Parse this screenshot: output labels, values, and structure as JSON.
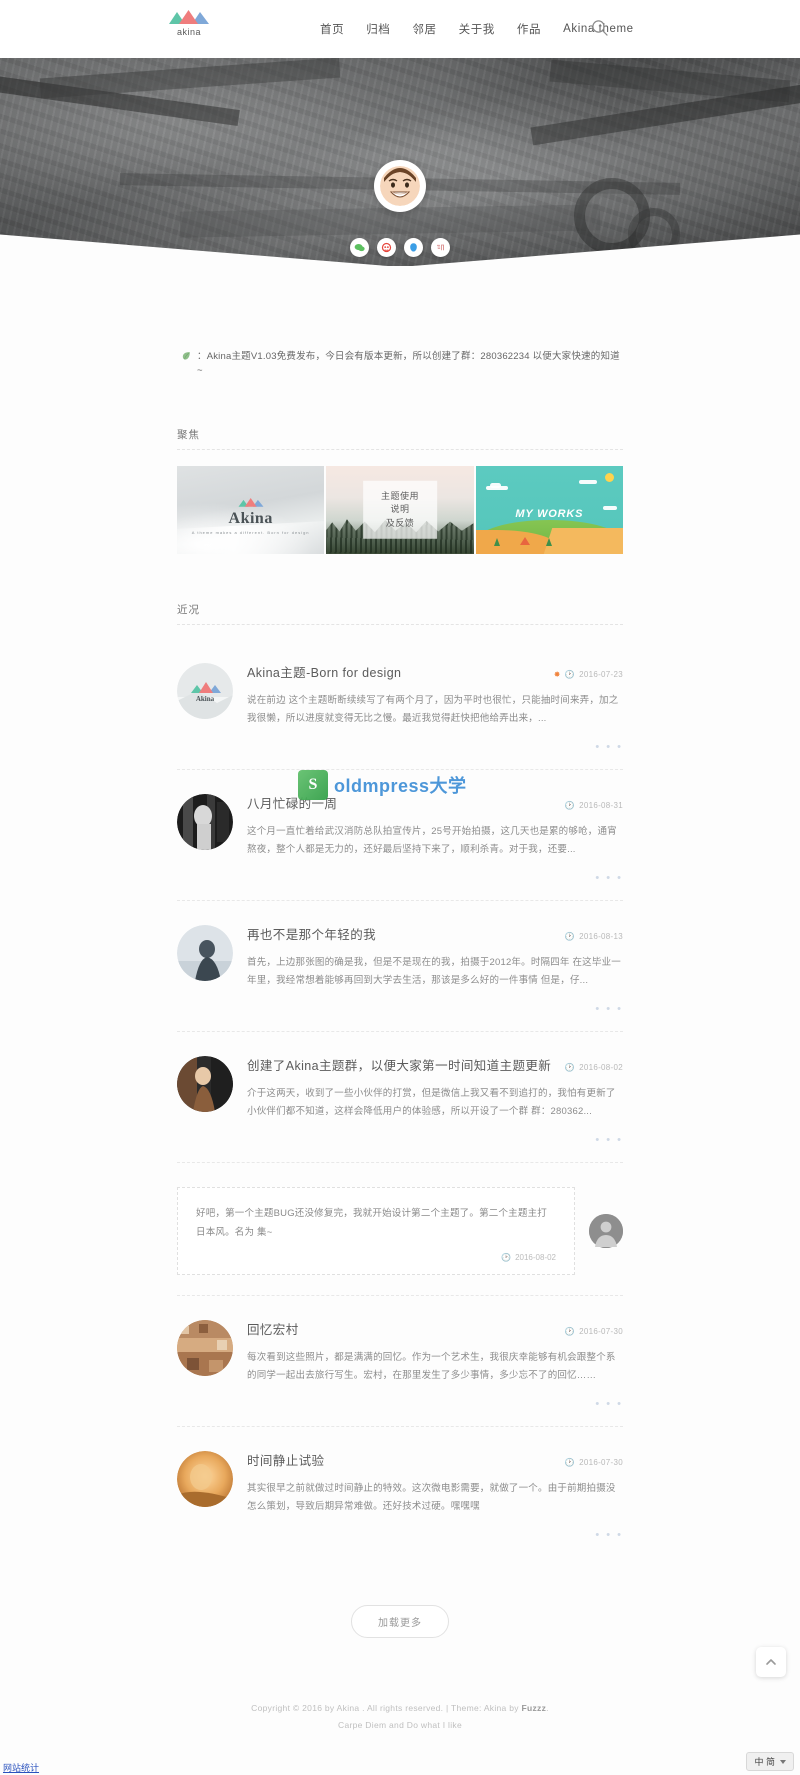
{
  "site": {
    "logo_word": "akina",
    "nav": [
      {
        "label": "首页"
      },
      {
        "label": "归档"
      },
      {
        "label": "邻居"
      },
      {
        "label": "关于我"
      },
      {
        "label": "作品"
      },
      {
        "label": "Akina theme"
      }
    ],
    "search_icon": "search-icon"
  },
  "hero": {
    "avatar_alt": "avatar",
    "social": [
      {
        "name": "wechat-icon",
        "color": "#5cc060"
      },
      {
        "name": "weibo-icon",
        "color": "#e6453c"
      },
      {
        "name": "qq-icon",
        "color": "#3b9ee6"
      },
      {
        "name": "zhihu-icon",
        "color": "#d98b8b"
      }
    ]
  },
  "notice": {
    "icon": "leaf-icon",
    "text": "：Akina主题V1.03免费发布，今日会有版本更新，所以创建了群：280362234 以便大家快速的知道~"
  },
  "focus": {
    "heading": "聚焦",
    "cards": [
      {
        "name": "akina-theme-card",
        "title": "Akina",
        "subtitle": "A theme makes a different. Born for design"
      },
      {
        "name": "theme-guide-card",
        "label": "主题使用说明\n及反馈"
      },
      {
        "name": "my-works-card",
        "label": "MY WORKS"
      }
    ]
  },
  "recent": {
    "heading": "近况",
    "posts": [
      {
        "title": "Akina主题-Born for design",
        "hot": true,
        "date": "2016-07-23",
        "excerpt": "说在前边 这个主题断断续续写了有两个月了，因为平时也很忙，只能抽时间来弄，加之我很懒，所以进度就变得无比之慢。最近我觉得赶快把他给弄出来，...",
        "dots": "• • •"
      },
      {
        "title": "八月忙碌的一周",
        "hot": false,
        "date": "2016-08-31",
        "excerpt": "这个月一直忙着给武汉消防总队拍宣传片，25号开始拍摄，这几天也是累的够呛，通宵熬夜，整个人都是无力的，还好最后坚持下来了，顺利杀青。对于我，还要...",
        "dots": "• • •"
      },
      {
        "title": "再也不是那个年轻的我",
        "hot": false,
        "date": "2016-08-13",
        "excerpt": "首先，上边那张图的确是我，但是不是现在的我，拍摄于2012年。时隔四年 在这毕业一年里，我经常想着能够再回到大学去生活，那该是多么好的一件事情 但是，仔...",
        "dots": "• • •"
      },
      {
        "title": "创建了Akina主题群，以便大家第一时间知道主题更新",
        "hot": false,
        "date": "2016-08-02",
        "excerpt": "介于这两天，收到了一些小伙伴的打赏，但是微信上我又看不到追打的，我怕有更新了小伙伴们都不知道，这样会降低用户的体验感，所以开设了一个群 群：280362...",
        "dots": "• • •"
      }
    ],
    "quote": {
      "text": "好吧，第一个主题BUG还没修复完，我就开始设计第二个主题了。第二个主题主打日本风。名为  集~",
      "date": "2016-08-02"
    },
    "posts_after": [
      {
        "title": "回忆宏村",
        "hot": false,
        "date": "2016-07-30",
        "excerpt": "每次看到这些照片，都是满满的回忆。作为一个艺术生，我很庆幸能够有机会跟整个系的同学一起出去旅行写生。宏村，在那里发生了多少事情，多少忘不了的回忆……",
        "dots": "• • •"
      },
      {
        "title": "时间静止试验",
        "hot": false,
        "date": "2016-07-30",
        "excerpt": "其实很早之前就做过时间静止的特效。这次微电影需要，就做了一个。由于前期拍摄没怎么策划，导致后期异常难做。还好技术过硬。嘿嘿嘿",
        "dots": "• • •"
      }
    ],
    "load_more": "加载更多"
  },
  "footer": {
    "copyright_prefix": "Copyright © 2016 by Akina . All rights reserved.  |  Theme: Akina by ",
    "author_link": "Fuzzz",
    "copyright_suffix": ".",
    "tagline": "Carpe Diem and Do what I like"
  },
  "overlay": {
    "watermark_logo": "S",
    "watermark_text": "oldmpress大学"
  },
  "statusbar": {
    "link": "网站统计",
    "ime": "中 简"
  },
  "colors": {
    "accent_green": "#5cc060",
    "accent_red": "#e6453c",
    "accent_blue": "#3b9ee6",
    "hot": "#f0833c",
    "card_teal": "#55c7bb",
    "text_muted": "#8c8c8c"
  }
}
